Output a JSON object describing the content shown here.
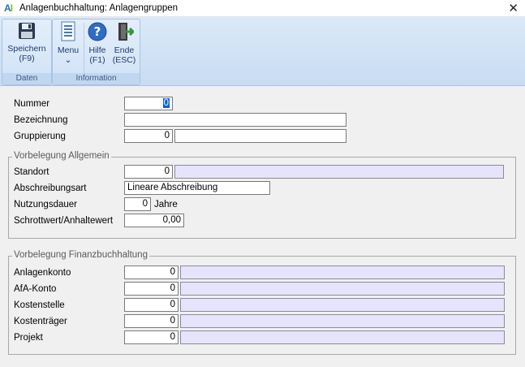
{
  "window": {
    "title": "Anlagenbuchhaltung: Anlagengruppen",
    "logo": "AI"
  },
  "ribbon": {
    "groups": [
      {
        "label": "Daten"
      },
      {
        "label": "Information"
      }
    ],
    "buttons": {
      "save": {
        "label": "Speichern",
        "shortcut": "(F9)",
        "icon": "floppy-disk-icon"
      },
      "menu": {
        "label": "Menu",
        "shortcut": "⌄",
        "icon": "document-list-icon"
      },
      "help": {
        "label": "Hilfe",
        "shortcut": "(F1)",
        "icon": "help-icon"
      },
      "exit": {
        "label": "Ende",
        "shortcut": "(ESC)",
        "icon": "exit-door-icon"
      }
    }
  },
  "form": {
    "nummer": {
      "label": "Nummer",
      "value": "0"
    },
    "bezeichnung": {
      "label": "Bezeichnung",
      "value": ""
    },
    "gruppierung": {
      "label": "Gruppierung",
      "value": "0",
      "text": ""
    }
  },
  "allgemein": {
    "legend": "Vorbelegung Allgemein",
    "standort": {
      "label": "Standort",
      "value": "0",
      "text": ""
    },
    "abschreibungsart": {
      "label": "Abschreibungsart",
      "value": "Lineare Abschreibung"
    },
    "nutzungsdauer": {
      "label": "Nutzungsdauer",
      "value": "0",
      "unit": "Jahre"
    },
    "schrottwert": {
      "label": "Schrottwert/Anhaltewert",
      "value": "0,00"
    }
  },
  "finanz": {
    "legend": "Vorbelegung Finanzbuchhaltung",
    "anlagenkonto": {
      "label": "Anlagenkonto",
      "value": "0",
      "text": ""
    },
    "afa_konto": {
      "label": "AfA-Konto",
      "value": "0",
      "text": ""
    },
    "kostenstelle": {
      "label": "Kostenstelle",
      "value": "0",
      "text": ""
    },
    "kostentraeger": {
      "label": "Kostenträger",
      "value": "0",
      "text": ""
    },
    "projekt": {
      "label": "Projekt",
      "value": "0",
      "text": ""
    }
  }
}
